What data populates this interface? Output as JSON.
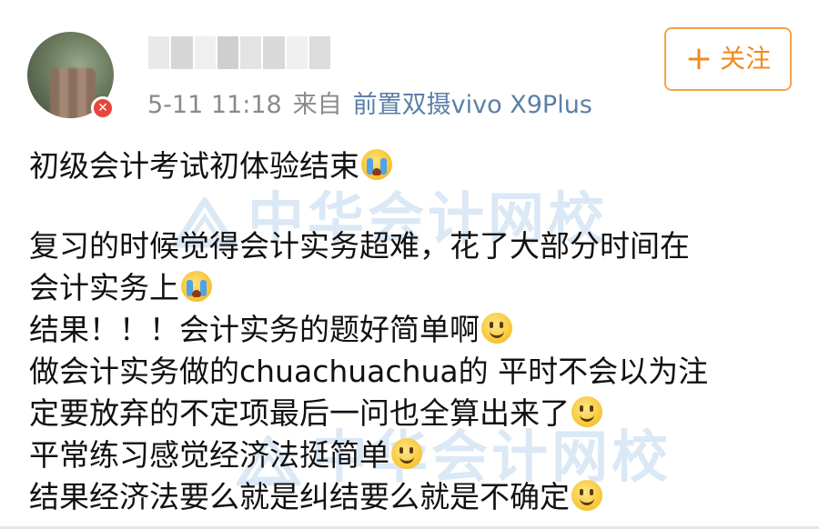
{
  "header": {
    "timestamp": "5-11 11:18",
    "source_prefix": "来自",
    "source_device": "前置双摄vivo X9Plus",
    "badge_glyph": "✕"
  },
  "follow": {
    "plus": "+",
    "label": "关注"
  },
  "watermark": {
    "text": "中华会计网校"
  },
  "post": {
    "lines": [
      {
        "text": "初级会计考试初体验结束",
        "emoji": "cry-icon"
      },
      {
        "text": "复习的时候觉得会计实务超难，花了大部分时间在",
        "emoji": ""
      },
      {
        "text": "会计实务上",
        "emoji": "cry-icon"
      },
      {
        "text": "结果！！！会计实务的题好简单啊",
        "emoji": "smile-icon"
      },
      {
        "text": "做会计实务做的chuachuachua的 平时不会以为注",
        "emoji": ""
      },
      {
        "text": "定要放弃的不定项最后一问也全算出来了",
        "emoji": "smile-icon"
      },
      {
        "text": "平常练习感觉经济法挺简单",
        "emoji": "smile-icon"
      },
      {
        "text": "结果经济法要么就是纠结要么就是不确定",
        "emoji": "smile-icon"
      }
    ]
  },
  "colors": {
    "accent_orange": "#f28a1e",
    "source_blue": "#5b7fa8",
    "meta_gray": "#8a8a8a",
    "watermark_blue": "#dbe8f5"
  }
}
